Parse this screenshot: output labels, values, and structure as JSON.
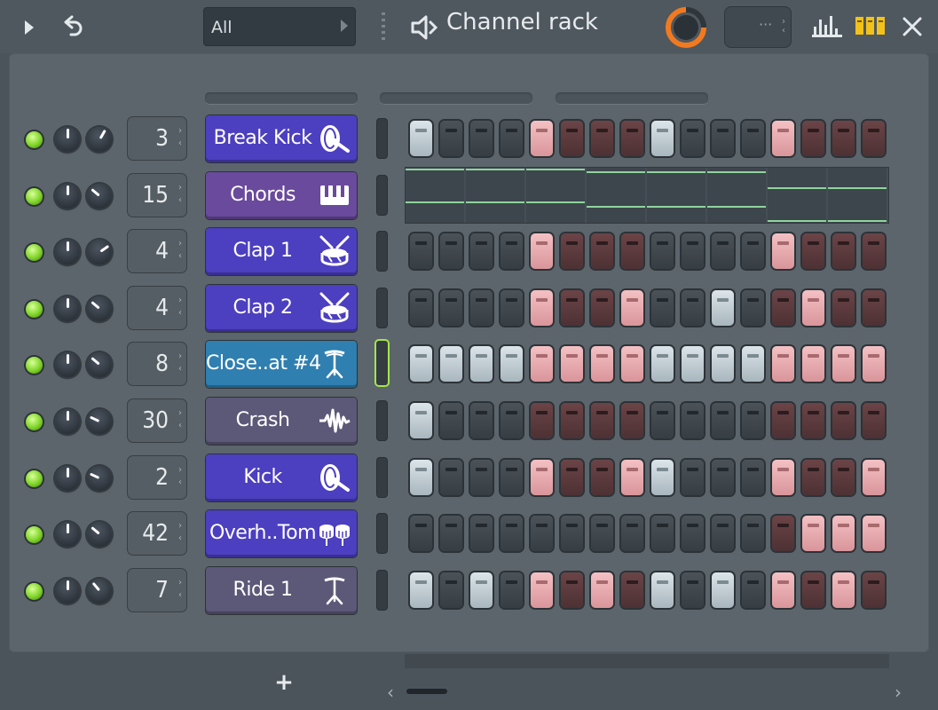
{
  "toolbar": {
    "filter_value": "All",
    "title": "Channel rack",
    "pattern_value": "···"
  },
  "colors": {
    "step_off": "#3c4449",
    "step_on_light": "#c9d4da",
    "step_dark_red": "#5c3a3d",
    "step_on_pink": "#eeb1b5",
    "led_green": "#7fd427",
    "accent_orange": "#f07a22",
    "select_green": "#a5e64a"
  },
  "channels": [
    {
      "name": "Break Kick",
      "mixer": "3",
      "icon": "kick-icon",
      "color": "#4c3fc0",
      "steps": [
        1,
        0,
        0,
        0,
        3,
        2,
        2,
        2,
        1,
        0,
        0,
        0,
        3,
        2,
        2,
        2
      ],
      "vol": "high",
      "pan": "center",
      "selected": false
    },
    {
      "name": "Chords",
      "mixer": "15",
      "icon": "piano-icon",
      "color": "#6a4a9c",
      "steps": [],
      "vol": "high",
      "pan": "right",
      "selected": false,
      "piano_roll": true
    },
    {
      "name": "Clap 1",
      "mixer": "4",
      "icon": "drum-icon",
      "color": "#4c3fc0",
      "steps": [
        0,
        0,
        0,
        0,
        3,
        2,
        2,
        2,
        0,
        0,
        0,
        0,
        3,
        2,
        2,
        2
      ],
      "vol": "high",
      "pan": "right-up",
      "selected": false
    },
    {
      "name": "Clap 2",
      "mixer": "4",
      "icon": "drum-icon",
      "color": "#4c3fc0",
      "steps": [
        0,
        0,
        0,
        0,
        3,
        2,
        2,
        3,
        0,
        0,
        1,
        0,
        2,
        3,
        2,
        2
      ],
      "vol": "high",
      "pan": "right",
      "selected": false
    },
    {
      "name": "Close..at #4",
      "mixer": "8",
      "icon": "hihat-icon",
      "color": "#2f7fb0",
      "steps": [
        1,
        1,
        1,
        1,
        3,
        3,
        3,
        3,
        1,
        1,
        1,
        1,
        3,
        3,
        3,
        3
      ],
      "vol": "high",
      "pan": "right",
      "selected": true
    },
    {
      "name": "Crash",
      "mixer": "30",
      "icon": "wave-icon",
      "color": "#5c5878",
      "steps": [
        1,
        0,
        0,
        0,
        2,
        2,
        2,
        2,
        0,
        0,
        0,
        0,
        2,
        2,
        2,
        2
      ],
      "vol": "high",
      "pan": "right-down",
      "selected": false
    },
    {
      "name": "Kick",
      "mixer": "2",
      "icon": "kick-icon",
      "color": "#4c3fc0",
      "steps": [
        1,
        0,
        0,
        0,
        3,
        2,
        2,
        3,
        1,
        0,
        0,
        0,
        3,
        2,
        2,
        3
      ],
      "vol": "high",
      "pan": "right-down",
      "selected": false
    },
    {
      "name": "Overh..Tom",
      "mixer": "42",
      "icon": "toms-icon",
      "color": "#4c3fc0",
      "steps": [
        0,
        0,
        0,
        0,
        0,
        0,
        0,
        0,
        0,
        0,
        0,
        0,
        2,
        3,
        3,
        3
      ],
      "vol": "high",
      "pan": "right",
      "selected": false
    },
    {
      "name": "Ride 1",
      "mixer": "7",
      "icon": "cymbal-icon",
      "color": "#5c5878",
      "steps": [
        1,
        0,
        1,
        0,
        3,
        2,
        3,
        2,
        1,
        0,
        1,
        0,
        3,
        2,
        3,
        2
      ],
      "vol": "left",
      "pan": "right-up",
      "selected": false
    }
  ],
  "footer": {
    "add_label": "+",
    "scroll_left": "‹",
    "scroll_right": "›"
  }
}
